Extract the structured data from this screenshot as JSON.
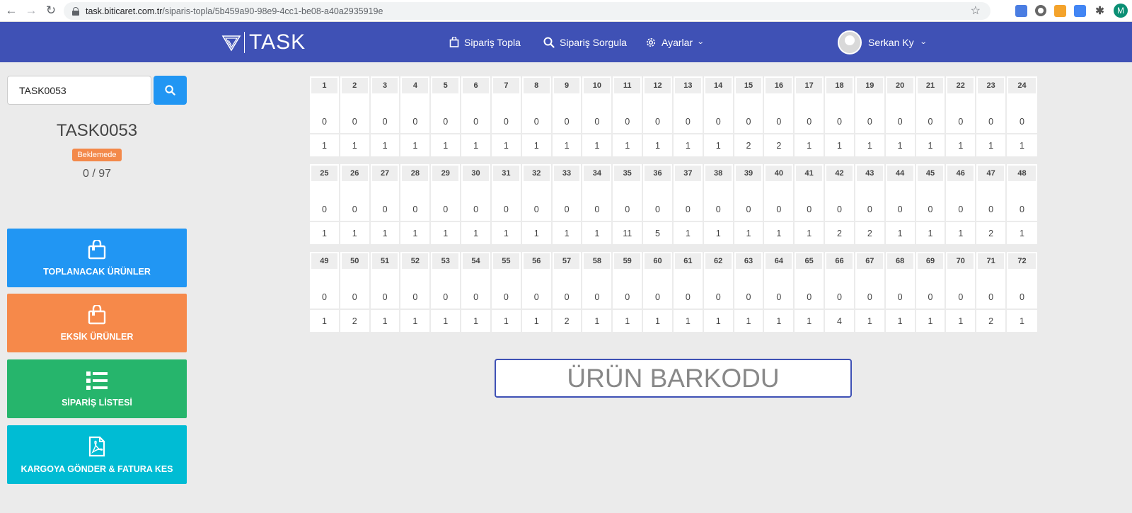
{
  "browser": {
    "url_host": "task.biticaret.com.tr",
    "url_path": "/siparis-topla/5b459a90-98e9-4cc1-be08-a40a2935919e",
    "profile_initial": "M"
  },
  "header": {
    "logo_text": "TASK",
    "nav": {
      "collect": "Sipariş Topla",
      "query": "Sipariş Sorgula",
      "settings": "Ayarlar"
    },
    "user_name": "Serkan Ky"
  },
  "sidebar": {
    "search_value": "TASK0053",
    "order_code": "TASK0053",
    "status": "Beklemede",
    "progress": "0 / 97",
    "buttons": {
      "to_collect": "TOPLANACAK ÜRÜNLER",
      "missing": "EKSİK ÜRÜNLER",
      "order_list": "SİPARİŞ LİSTESİ",
      "ship_invoice": "KARGOYA GÖNDER & FATURA KES"
    }
  },
  "grid": {
    "rows": [
      {
        "nums": [
          "1",
          "2",
          "3",
          "4",
          "5",
          "6",
          "7",
          "8",
          "9",
          "10",
          "11",
          "12",
          "13",
          "14",
          "15",
          "16",
          "17",
          "18",
          "19",
          "20",
          "21",
          "22",
          "23",
          "24"
        ],
        "counts": [
          "0",
          "0",
          "0",
          "0",
          "0",
          "0",
          "0",
          "0",
          "0",
          "0",
          "0",
          "0",
          "0",
          "0",
          "0",
          "0",
          "0",
          "0",
          "0",
          "0",
          "0",
          "0",
          "0",
          "0"
        ],
        "qtys": [
          "1",
          "1",
          "1",
          "1",
          "1",
          "1",
          "1",
          "1",
          "1",
          "1",
          "1",
          "1",
          "1",
          "1",
          "2",
          "2",
          "1",
          "1",
          "1",
          "1",
          "1",
          "1",
          "1",
          "1"
        ]
      },
      {
        "nums": [
          "25",
          "26",
          "27",
          "28",
          "29",
          "30",
          "31",
          "32",
          "33",
          "34",
          "35",
          "36",
          "37",
          "38",
          "39",
          "40",
          "41",
          "42",
          "43",
          "44",
          "45",
          "46",
          "47",
          "48"
        ],
        "counts": [
          "0",
          "0",
          "0",
          "0",
          "0",
          "0",
          "0",
          "0",
          "0",
          "0",
          "0",
          "0",
          "0",
          "0",
          "0",
          "0",
          "0",
          "0",
          "0",
          "0",
          "0",
          "0",
          "0",
          "0"
        ],
        "qtys": [
          "1",
          "1",
          "1",
          "1",
          "1",
          "1",
          "1",
          "1",
          "1",
          "1",
          "11",
          "5",
          "1",
          "1",
          "1",
          "1",
          "1",
          "2",
          "2",
          "1",
          "1",
          "1",
          "2",
          "1"
        ]
      },
      {
        "nums": [
          "49",
          "50",
          "51",
          "52",
          "53",
          "54",
          "55",
          "56",
          "57",
          "58",
          "59",
          "60",
          "61",
          "62",
          "63",
          "64",
          "65",
          "66",
          "67",
          "68",
          "69",
          "70",
          "71",
          "72"
        ],
        "counts": [
          "0",
          "0",
          "0",
          "0",
          "0",
          "0",
          "0",
          "0",
          "0",
          "0",
          "0",
          "0",
          "0",
          "0",
          "0",
          "0",
          "0",
          "0",
          "0",
          "0",
          "0",
          "0",
          "0",
          "0"
        ],
        "qtys": [
          "1",
          "2",
          "1",
          "1",
          "1",
          "1",
          "1",
          "1",
          "2",
          "1",
          "1",
          "1",
          "1",
          "1",
          "1",
          "1",
          "1",
          "4",
          "1",
          "1",
          "1",
          "1",
          "2",
          "1"
        ]
      }
    ]
  },
  "barcode": {
    "placeholder": "ÜRÜN BARKODU"
  }
}
